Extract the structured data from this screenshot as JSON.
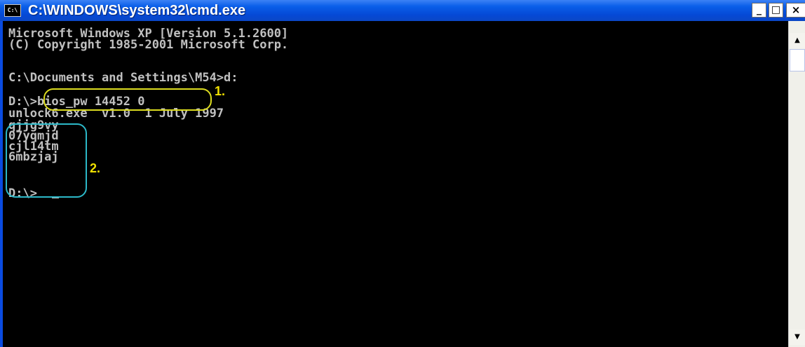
{
  "window": {
    "icon_text": "C:\\",
    "title": "C:\\WINDOWS\\system32\\cmd.exe",
    "minimize_glyph": "_",
    "maximize_glyph": "□",
    "close_glyph": "×"
  },
  "console": {
    "lines": [
      "Microsoft Windows XP [Version 5.1.2600]",
      "(C) Copyright 1985-2001 Microsoft Corp.",
      "",
      "C:\\Documents and Settings\\M54>d:",
      "",
      "D:\\>bios_pw 14452 0",
      "unlock6.exe  v1.0  1 July 1997",
      "qjjg9vy",
      "07yqmjd",
      "cjl14tm",
      "6mbzjaj",
      "",
      "D:\\>"
    ]
  },
  "annotations": {
    "marker_1": "1.",
    "marker_2": "2."
  },
  "scrollbar": {
    "up_glyph": "▲",
    "down_glyph": "▼"
  },
  "colors": {
    "titlebar": "#0549d6",
    "console_bg": "#000000",
    "console_text": "#c0c0c0",
    "oval_1": "#dcdc20",
    "oval_2": "#2cb8c8",
    "marker": "#f0e000"
  }
}
